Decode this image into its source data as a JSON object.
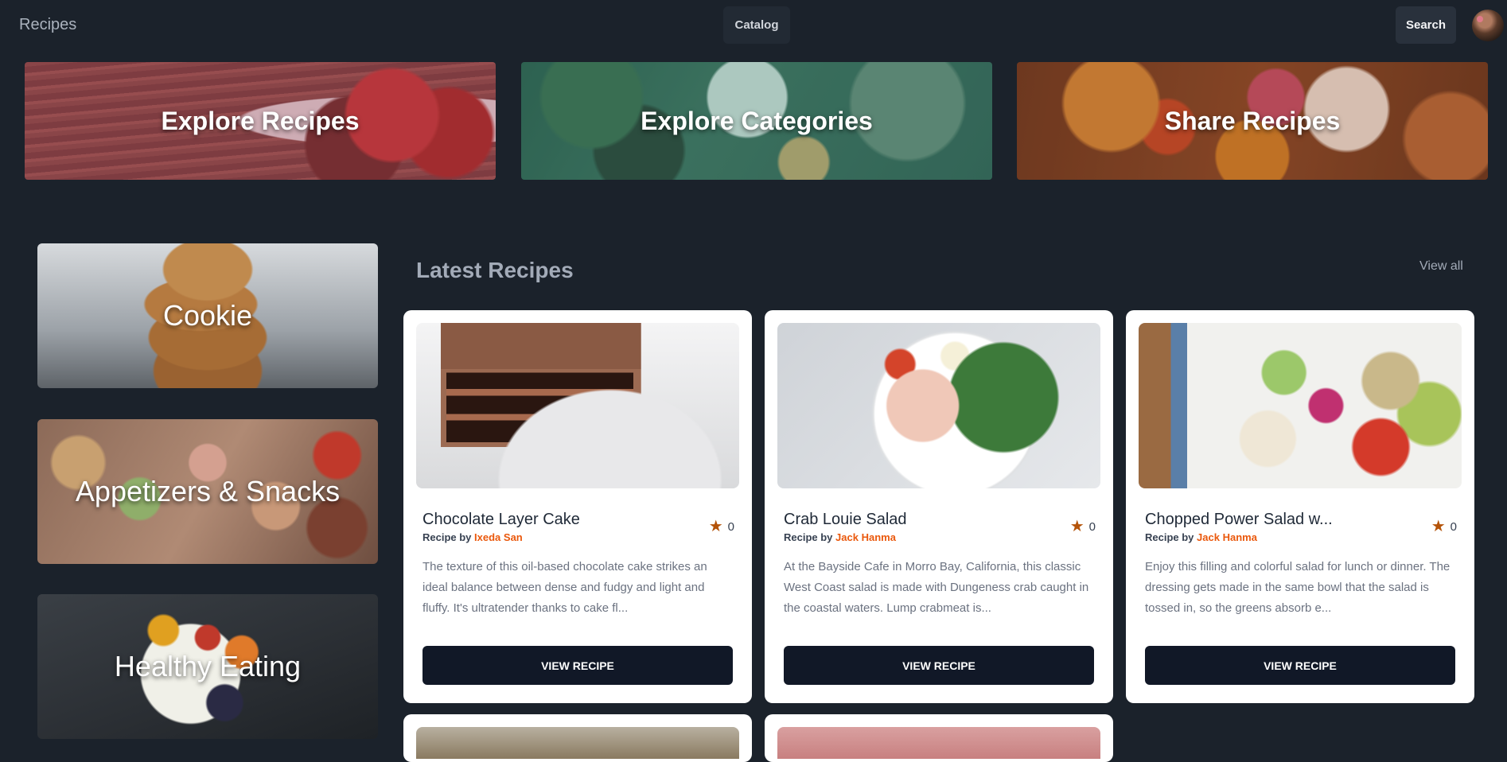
{
  "header": {
    "brand": "Recipes",
    "catalog_label": "Catalog",
    "search_label": "Search"
  },
  "heroes": [
    {
      "label": "Explore Recipes"
    },
    {
      "label": "Explore Categories"
    },
    {
      "label": "Share Recipes"
    }
  ],
  "categories": [
    {
      "label": "Cookie"
    },
    {
      "label": "Appetizers & Snacks"
    },
    {
      "label": "Healthy Eating"
    }
  ],
  "latest": {
    "title": "Latest Recipes",
    "view_all": "View all"
  },
  "recipes": [
    {
      "title": "Chocolate Layer Cake",
      "by_prefix": "Recipe by",
      "author": "Ixeda San",
      "rating": "0",
      "description": "The texture of this oil-based chocolate cake strikes an ideal balance between dense and fudgy and light and fluffy. It's ultratender thanks to cake fl...",
      "button": "VIEW RECIPE"
    },
    {
      "title": "Crab Louie Salad",
      "by_prefix": "Recipe by",
      "author": "Jack Hanma",
      "rating": "0",
      "description": "At the Bayside Cafe in Morro Bay, California, this classic West Coast salad is made with Dungeness crab caught in the coastal waters. Lump crabmeat is...",
      "button": "VIEW RECIPE"
    },
    {
      "title": "Chopped Power Salad w...",
      "by_prefix": "Recipe by",
      "author": "Jack Hanma",
      "rating": "0",
      "description": "Enjoy this filling and colorful salad for lunch or dinner. The dressing gets made in the same bowl that the salad is tossed in, so the greens absorb e...",
      "button": "VIEW RECIPE"
    }
  ],
  "colors": {
    "background": "#1b222b",
    "accent_author": "#ea580c",
    "button_dark": "#111827",
    "star": "#b45309"
  }
}
